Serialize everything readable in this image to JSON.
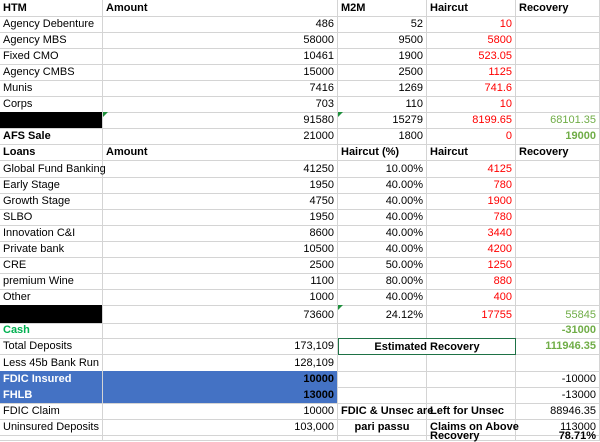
{
  "headers": [
    "HTM",
    "Amount",
    "M2M",
    "Haircut",
    "Recovery"
  ],
  "htm_rows": [
    {
      "name": "Agency Debenture",
      "amount": "486",
      "m2m": "52",
      "haircut": "10",
      "recovery": ""
    },
    {
      "name": "Agency MBS",
      "amount": "58000",
      "m2m": "9500",
      "haircut": "5800",
      "recovery": ""
    },
    {
      "name": "Fixed CMO",
      "amount": "10461",
      "m2m": "1900",
      "haircut": "523.05",
      "recovery": ""
    },
    {
      "name": "Agency CMBS",
      "amount": "15000",
      "m2m": "2500",
      "haircut": "1125",
      "recovery": ""
    },
    {
      "name": "Munis",
      "amount": "7416",
      "m2m": "1269",
      "haircut": "741.6",
      "recovery": ""
    },
    {
      "name": "Corps",
      "amount": "703",
      "m2m": "110",
      "haircut": "10",
      "recovery": ""
    }
  ],
  "htm_total": {
    "amount": "91580",
    "m2m": "15279",
    "haircut": "8199.65",
    "recovery": "68101.35"
  },
  "afs": {
    "name": "AFS Sale",
    "amount": "21000",
    "m2m": "1800",
    "haircut": "0",
    "recovery": "19000"
  },
  "loans_headers": [
    "Loans",
    "Amount",
    "Haircut (%)",
    "Haircut",
    "Recovery"
  ],
  "loans_rows": [
    {
      "name": "Global Fund Banking",
      "amount": "41250",
      "pct": "10.00%",
      "haircut": "4125"
    },
    {
      "name": "Early Stage",
      "amount": "1950",
      "pct": "40.00%",
      "haircut": "780"
    },
    {
      "name": "Growth Stage",
      "amount": "4750",
      "pct": "40.00%",
      "haircut": "1900"
    },
    {
      "name": "SLBO",
      "amount": "1950",
      "pct": "40.00%",
      "haircut": "780"
    },
    {
      "name": "Innovation C&I",
      "amount": "8600",
      "pct": "40.00%",
      "haircut": "3440"
    },
    {
      "name": "Private bank",
      "amount": "10500",
      "pct": "40.00%",
      "haircut": "4200"
    },
    {
      "name": "CRE",
      "amount": "2500",
      "pct": "50.00%",
      "haircut": "1250"
    },
    {
      "name": "premium Wine",
      "amount": "1100",
      "pct": "80.00%",
      "haircut": "880"
    },
    {
      "name": "Other",
      "amount": "1000",
      "pct": "40.00%",
      "haircut": "400"
    }
  ],
  "loans_total": {
    "amount": "73600",
    "pct": "24.12%",
    "haircut": "17755",
    "recovery": "55845"
  },
  "cash": {
    "name": "Cash",
    "recovery": "-31000"
  },
  "total_deposits": {
    "name": "Total Deposits",
    "amount": "173,109",
    "label": "Estimated Recovery",
    "recovery": "111946.35"
  },
  "bank_run": {
    "name": "Less 45b Bank Run",
    "amount": "128,109"
  },
  "fdic_insured": {
    "name": "FDIC Insured",
    "amount": "10000",
    "recovery": "-10000"
  },
  "fhlb": {
    "name": "FHLB",
    "amount": "13000",
    "recovery": "-13000"
  },
  "fdic_claim": {
    "name": "FDIC Claim",
    "amount": "10000",
    "note": "FDIC & Unsec are",
    "label": "Left for Unsec",
    "recovery": "88946.35"
  },
  "uninsured": {
    "name": "Uninsured Deposits",
    "amount": "103,000",
    "note": "pari passu",
    "label": "Claims on Above",
    "recovery": "113000"
  },
  "recovery_final": {
    "label": "Recovery",
    "value": "78.71%"
  },
  "colors": {
    "haircut_red": "#ff0000",
    "recovery_green": "#70ad47",
    "cash_green": "#00b050",
    "highlight_blue": "#4472c4",
    "redacted_black": "#000000"
  }
}
